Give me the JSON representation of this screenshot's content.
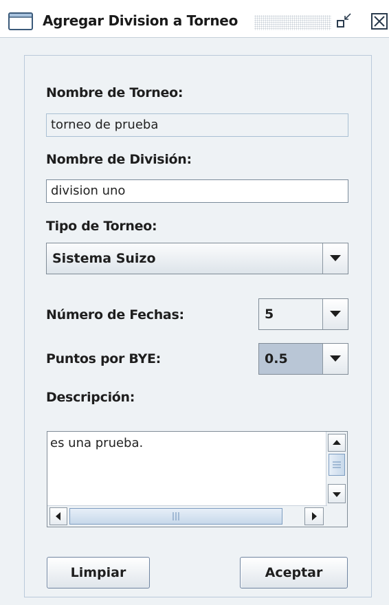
{
  "window": {
    "title": "Agregar Division a Torneo"
  },
  "form": {
    "tournament_name_label": "Nombre de Torneo:",
    "tournament_name_value": "torneo de prueba",
    "division_name_label": "Nombre de División:",
    "division_name_value": "division uno",
    "tournament_type_label": "Tipo de Torneo:",
    "tournament_type_value": "Sistema Suizo",
    "rounds_label": "Número de Fechas:",
    "rounds_value": "5",
    "bye_points_label": "Puntos por BYE:",
    "bye_points_value": "0.5",
    "description_label": "Descripción:",
    "description_value": "es una prueba."
  },
  "buttons": {
    "clear": "Limpiar",
    "accept": "Aceptar"
  },
  "icons": {
    "app": "window-icon",
    "restore": "restore-icon",
    "close": "close-icon",
    "dropdown": "chevron-down-icon"
  },
  "colors": {
    "background": "#eef2f5",
    "border_accent": "#b9c9da",
    "selected_value": "#b9c6d6"
  }
}
